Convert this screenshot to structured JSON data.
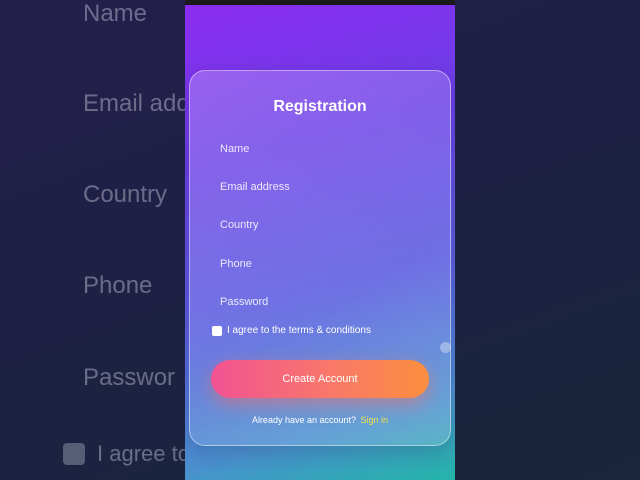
{
  "background_labels": {
    "name": "Name",
    "email": "Email add",
    "country": "Country",
    "phone": "Phone",
    "password": "Passwor",
    "agree": "I agree to"
  },
  "form": {
    "title": "Registration",
    "fields": {
      "name_placeholder": "Name",
      "email_placeholder": "Email address",
      "country_placeholder": "Country",
      "phone_placeholder": "Phone",
      "password_placeholder": "Password"
    },
    "terms_label": "I agree to the terms & conditions",
    "terms_checked": false,
    "submit_label": "Create Account",
    "signin_prompt": "Already have an account?",
    "signin_link": "Sign in"
  },
  "colors": {
    "accent_start": "#f25293",
    "accent_end": "#fb8f3e",
    "link": "#f2e14a",
    "gradient_top": "#8c2cf0",
    "gradient_bottom": "#23b6a8"
  }
}
